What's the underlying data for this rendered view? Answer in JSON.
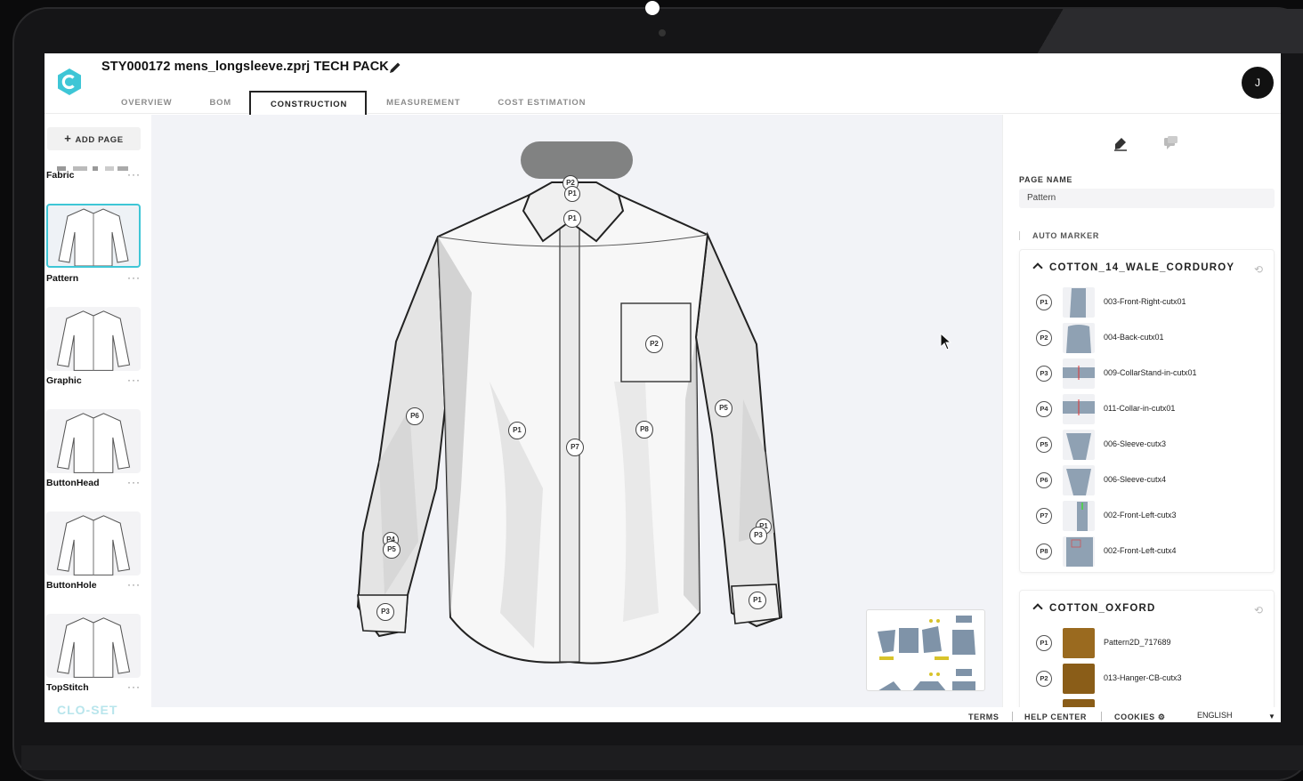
{
  "app": {
    "title": "STY000172 mens_longsleeve.zprj TECH PACK",
    "avatar_initial": "J",
    "accent": "#3ec6d6",
    "footer_brand": "CLO-SET"
  },
  "tabs": [
    {
      "label": "OVERVIEW"
    },
    {
      "label": "BOM"
    },
    {
      "label": "CONSTRUCTION",
      "active": true
    },
    {
      "label": "MEASUREMENT"
    },
    {
      "label": "COST ESTIMATION"
    }
  ],
  "sidebar": {
    "add_page_label": "ADD PAGE",
    "more_label": "···",
    "pages": [
      {
        "name": "Fabric"
      },
      {
        "name": "Pattern",
        "active": true
      },
      {
        "name": "Graphic"
      },
      {
        "name": "ButtonHead"
      },
      {
        "name": "ButtonHole"
      },
      {
        "name": "TopStitch"
      }
    ]
  },
  "canvas": {
    "pins": [
      "P2",
      "P1",
      "P1",
      "P2",
      "P6",
      "P1",
      "P7",
      "P8",
      "P5",
      "P4",
      "P5",
      "P3",
      "P1",
      "P3",
      "P1"
    ]
  },
  "right_panel": {
    "page_name_label": "PAGE NAME",
    "page_name_value": "Pattern",
    "auto_marker_label": "AUTO MARKER",
    "fabrics": [
      {
        "name": "COTTON_14_WALE_CORDUROY",
        "pieces": [
          {
            "badge": "P1",
            "label": "003-Front-Right-cutx01"
          },
          {
            "badge": "P2",
            "label": "004-Back-cutx01"
          },
          {
            "badge": "P3",
            "label": "009-CollarStand-in-cutx01"
          },
          {
            "badge": "P4",
            "label": "011-Collar-in-cutx01"
          },
          {
            "badge": "P5",
            "label": "006-Sleeve-cutx3"
          },
          {
            "badge": "P6",
            "label": "006-Sleeve-cutx4"
          },
          {
            "badge": "P7",
            "label": "002-Front-Left-cutx3"
          },
          {
            "badge": "P8",
            "label": "002-Front-Left-cutx4"
          }
        ]
      },
      {
        "name": "COTTON_OXFORD",
        "pieces": [
          {
            "badge": "P1",
            "label": "Pattern2D_717689"
          },
          {
            "badge": "P2",
            "label": "013-Hanger-CB-cutx3"
          }
        ]
      }
    ]
  },
  "footer": {
    "terms": "TERMS",
    "help": "HELP CENTER",
    "cookies": "COOKIES",
    "language": "ENGLISH"
  }
}
